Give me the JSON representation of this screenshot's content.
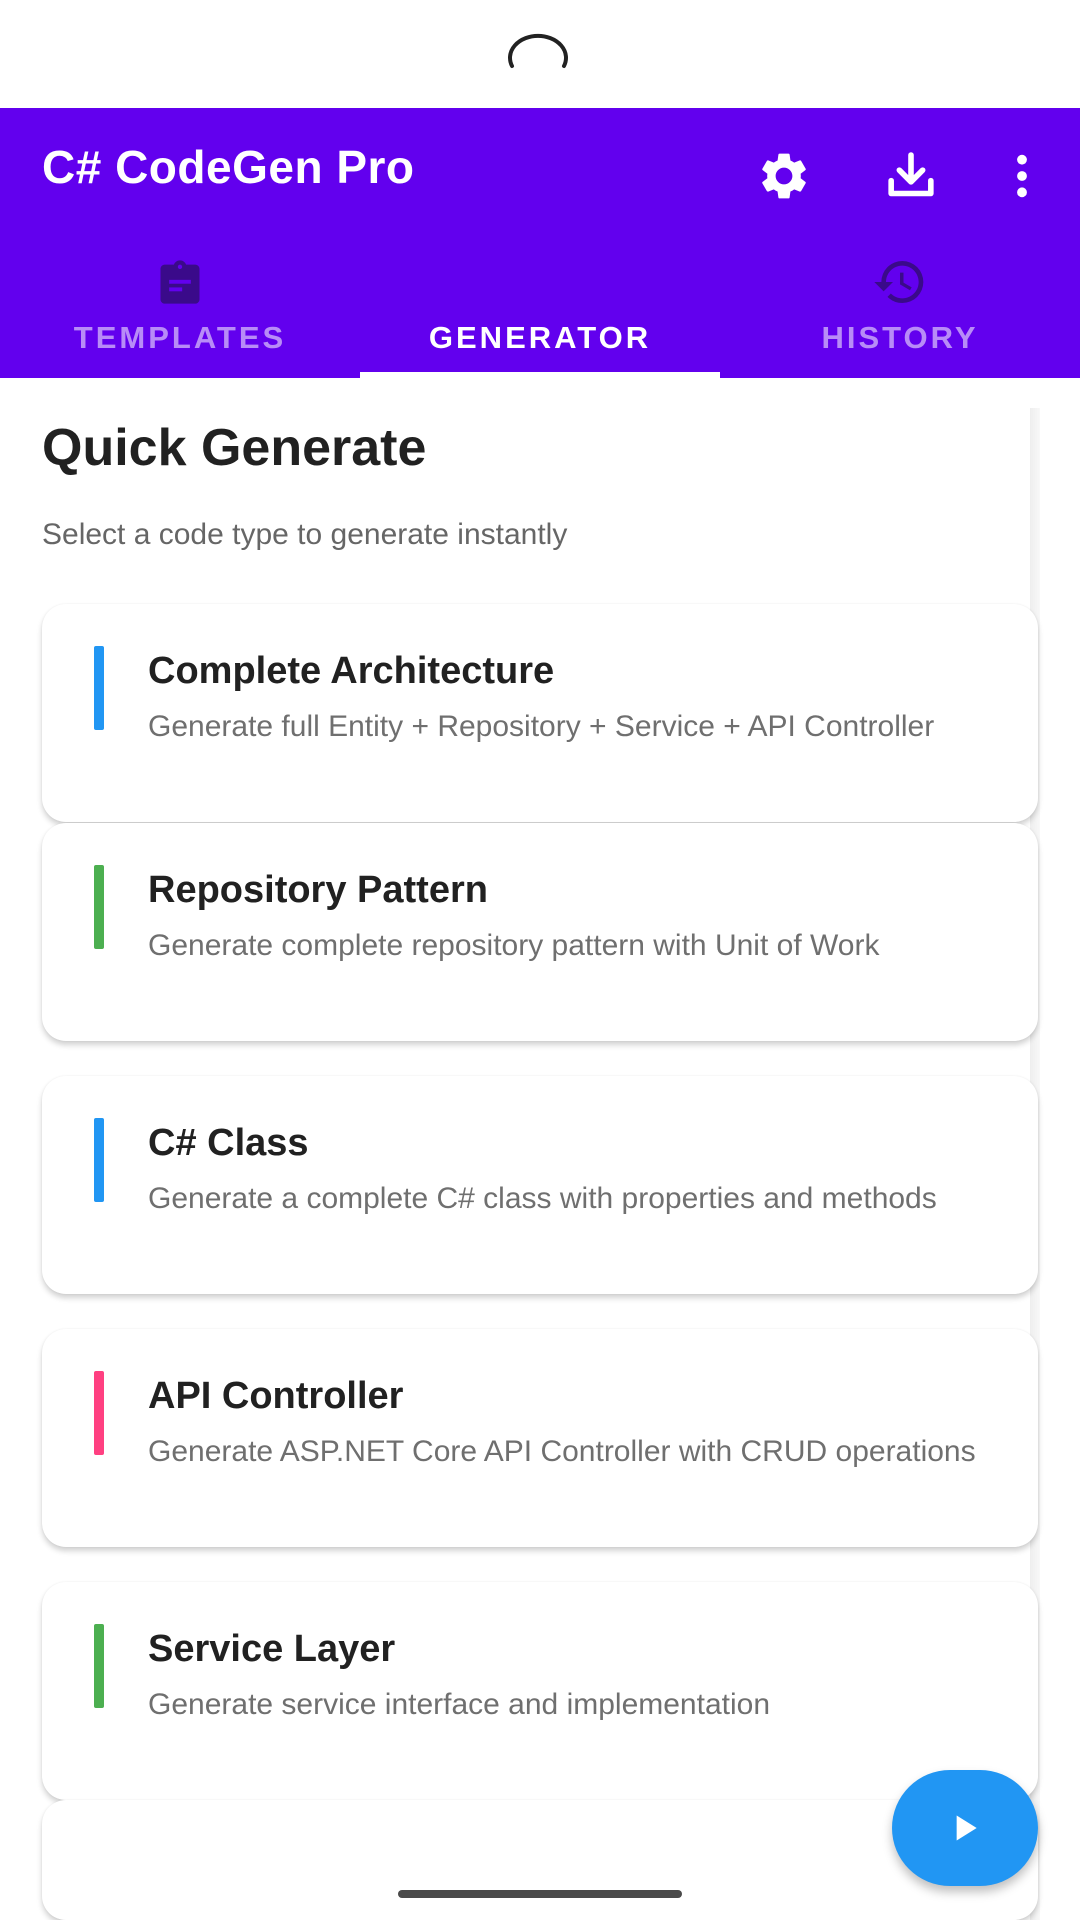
{
  "app": {
    "title": "C# CodeGen Pro",
    "accent_color": "#6200ee",
    "actions": [
      {
        "name": "settings",
        "icon": "gear-icon"
      },
      {
        "name": "download",
        "icon": "download-icon"
      },
      {
        "name": "more",
        "icon": "more-vert-icon"
      }
    ]
  },
  "tabs": [
    {
      "label": "TEMPLATES",
      "icon": "clipboard-icon",
      "active": false
    },
    {
      "label": "GENERATOR",
      "icon": "code-icon",
      "active": true
    },
    {
      "label": "HISTORY",
      "icon": "history-icon",
      "active": false
    }
  ],
  "main": {
    "title": "Quick Generate",
    "subtitle": "Select a code type to generate instantly",
    "cards": [
      {
        "title": "Complete Architecture",
        "description": "Generate full Entity + Repository + Service + API Controller",
        "accent": "#2196f3"
      },
      {
        "title": "Repository Pattern",
        "description": "Generate complete repository pattern with Unit of Work",
        "accent": "#4caf50"
      },
      {
        "title": "C# Class",
        "description": "Generate a complete C# class with properties and methods",
        "accent": "#2196f3"
      },
      {
        "title": "API Controller",
        "description": "Generate ASP.NET Core API Controller with CRUD operations",
        "accent": "#ff4081"
      },
      {
        "title": "Service Layer",
        "description": "Generate service interface and implementation",
        "accent": "#4caf50"
      }
    ]
  },
  "fab": {
    "icon": "play-icon",
    "color": "#2196f3"
  }
}
